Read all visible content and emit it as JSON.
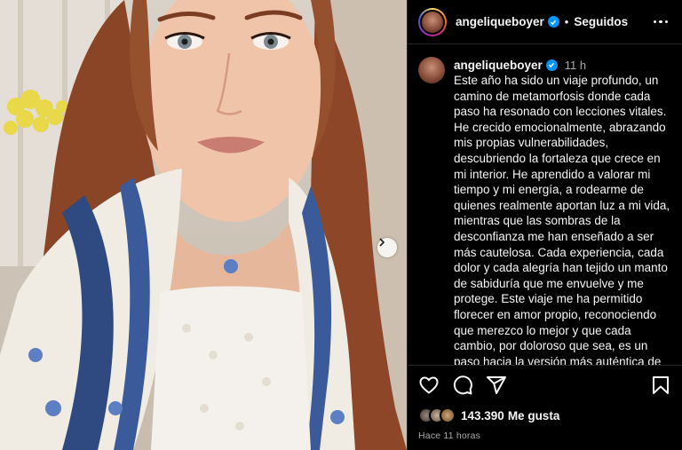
{
  "post": {
    "username": "angeliqueboyer",
    "follow_label": "Seguidos",
    "separator": "•",
    "caption": {
      "username": "angeliqueboyer",
      "time": "11 h",
      "text": "Este año ha sido un viaje profundo, un camino de metamorfosis donde cada paso ha resonado con lecciones vitales. He crecido emocionalmente, abrazando mis propias vulnerabilidades, descubriendo la fortaleza que crece en mi interior. He aprendido a valorar mi tiempo y mi energía, a rodearme de quienes realmente aportan luz a mi vida, mientras que las sombras de la desconfianza me han enseñado a ser más cautelosa. Cada experiencia, cada dolor y cada alegría han tejido un manto de sabiduría que me envuelve y me protege. Este viaje me ha permitido florecer en amor propio, reconociendo que merezco lo mejor y que cada cambio, por doloroso que sea, es un paso hacia la versión más auténtica de mí misma. Con gratitud en el corazón, miro hacia el futuro, lista para seguir aprendiendo"
    },
    "likes_count": "143.390",
    "likes_label": "Me gusta",
    "time_ago": "Hace 11 horas"
  },
  "icons": {
    "like": "heart-icon",
    "comment": "comment-icon",
    "share": "share-icon",
    "save": "bookmark-icon",
    "more": "more-options-icon",
    "verified": "verified-badge-icon",
    "next": "chevron-right-icon"
  },
  "colors": {
    "background": "#000000",
    "text": "#f5f5f5",
    "muted": "#a8a8a8",
    "verified": "#0095f6",
    "divider": "#262626"
  }
}
